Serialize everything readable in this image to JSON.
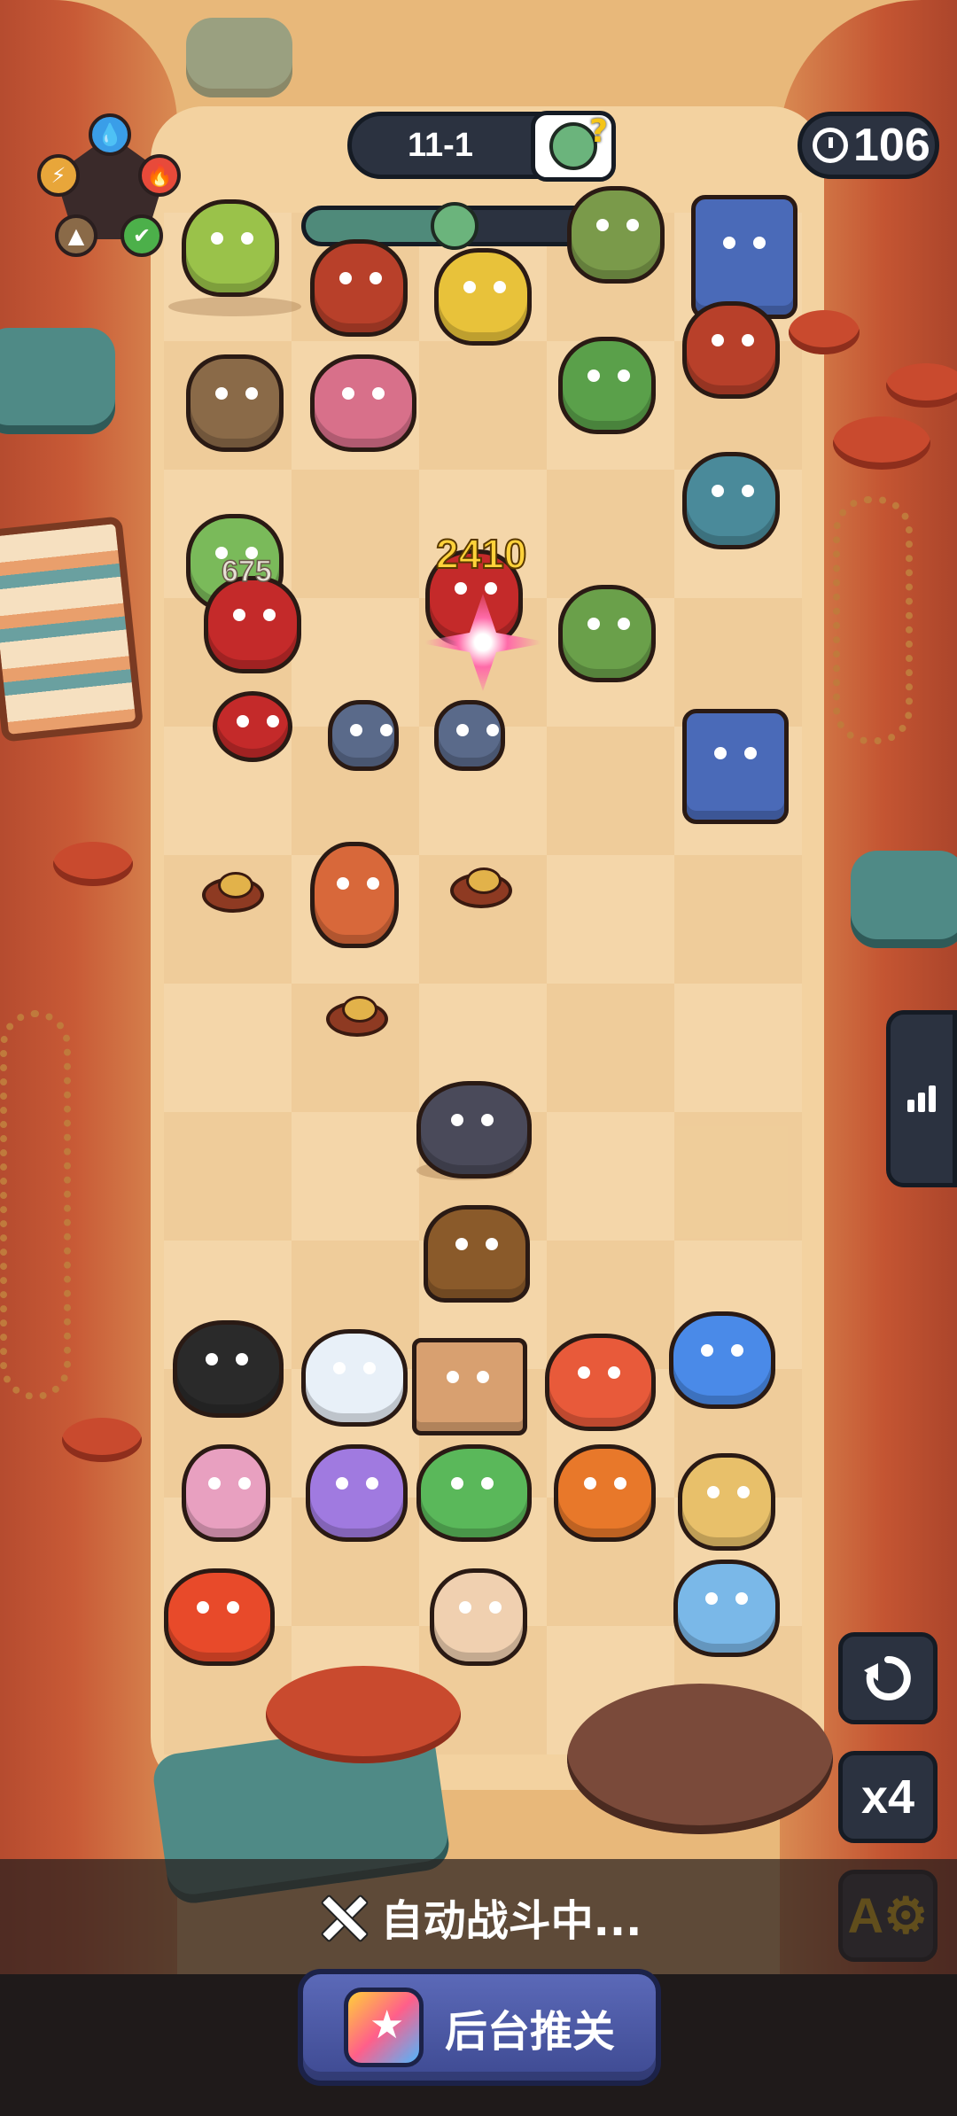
{
  "hud": {
    "stage_label": "11-1",
    "wave_progress": 0.45,
    "timer_value": "106",
    "elements": [
      {
        "name": "water",
        "glyph": "💧",
        "color": "#3a9ee8"
      },
      {
        "name": "fire",
        "glyph": "🔥",
        "color": "#e84a3a"
      },
      {
        "name": "nature",
        "glyph": "✔",
        "color": "#4cb04a"
      },
      {
        "name": "earth",
        "glyph": "▲",
        "color": "#8a6a48"
      },
      {
        "name": "lightning",
        "glyph": "⚡",
        "color": "#e8a63a"
      }
    ]
  },
  "battle": {
    "damage_numbers": [
      "2410",
      "675"
    ]
  },
  "controls": {
    "speed_label": "x4",
    "auto_battle_text": "自动战斗中...",
    "background_push_label": "后台推关"
  },
  "colors": {
    "hud_bg": "#2b3240",
    "button_blue": "#4e5ca8",
    "sand": "#f3d2a0",
    "cliff": "#c85a36"
  }
}
